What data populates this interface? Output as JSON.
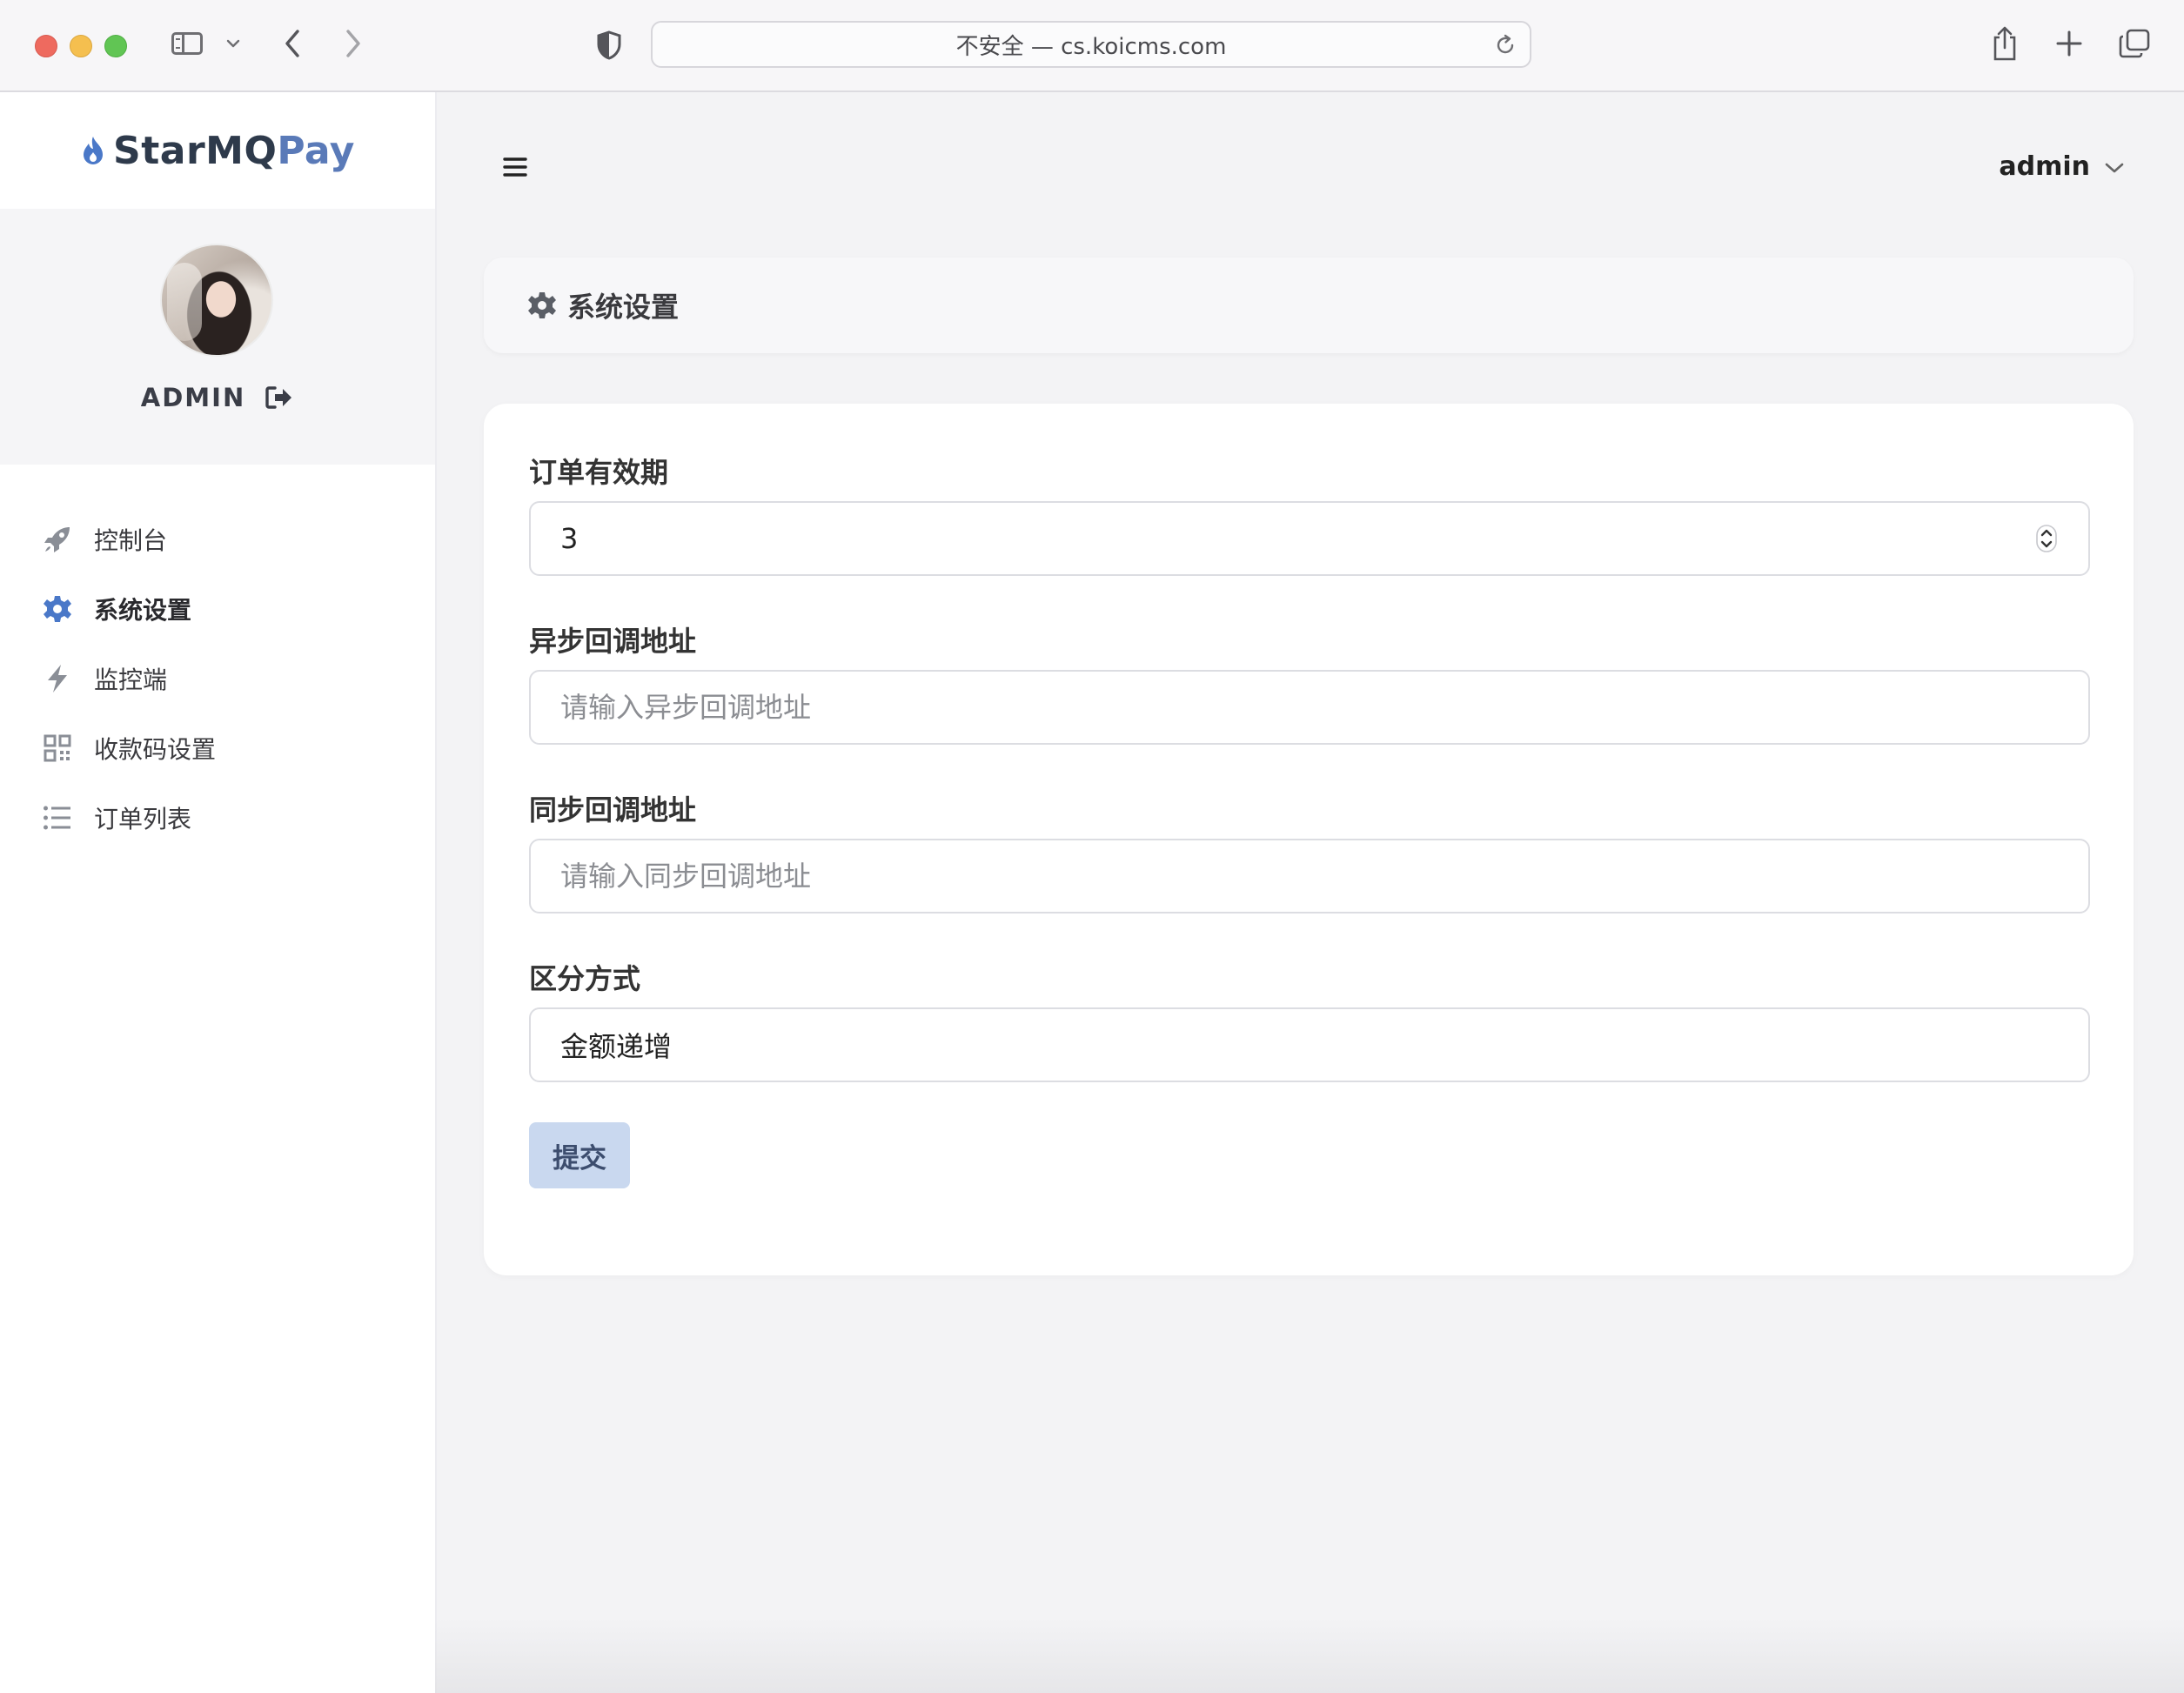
{
  "browser": {
    "address": "不安全 — cs.koicms.com"
  },
  "brand": {
    "part1": "StarMQ",
    "part2": "Pay",
    "color_dark": "#2e3a4b",
    "color_accent": "#5a7ab8"
  },
  "profile": {
    "name": "ADMIN"
  },
  "nav": {
    "items": [
      {
        "label": "控制台",
        "icon": "rocket-icon"
      },
      {
        "label": "系统设置",
        "icon": "gear-icon",
        "active": true
      },
      {
        "label": "监控端",
        "icon": "bolt-icon"
      },
      {
        "label": "收款码设置",
        "icon": "qrcode-icon"
      },
      {
        "label": "订单列表",
        "icon": "list-icon"
      }
    ]
  },
  "topbar": {
    "user": "admin"
  },
  "page": {
    "title": "系统设置"
  },
  "form": {
    "order_validity": {
      "label": "订单有效期",
      "value": "3"
    },
    "async_callback": {
      "label": "异步回调地址",
      "value": "",
      "placeholder": "请输入异步回调地址"
    },
    "sync_callback": {
      "label": "同步回调地址",
      "value": "",
      "placeholder": "请输入同步回调地址"
    },
    "distinguish": {
      "label": "区分方式",
      "value": "金额递增"
    },
    "submit_label": "提交",
    "submit_color": "#c9d8ef"
  }
}
